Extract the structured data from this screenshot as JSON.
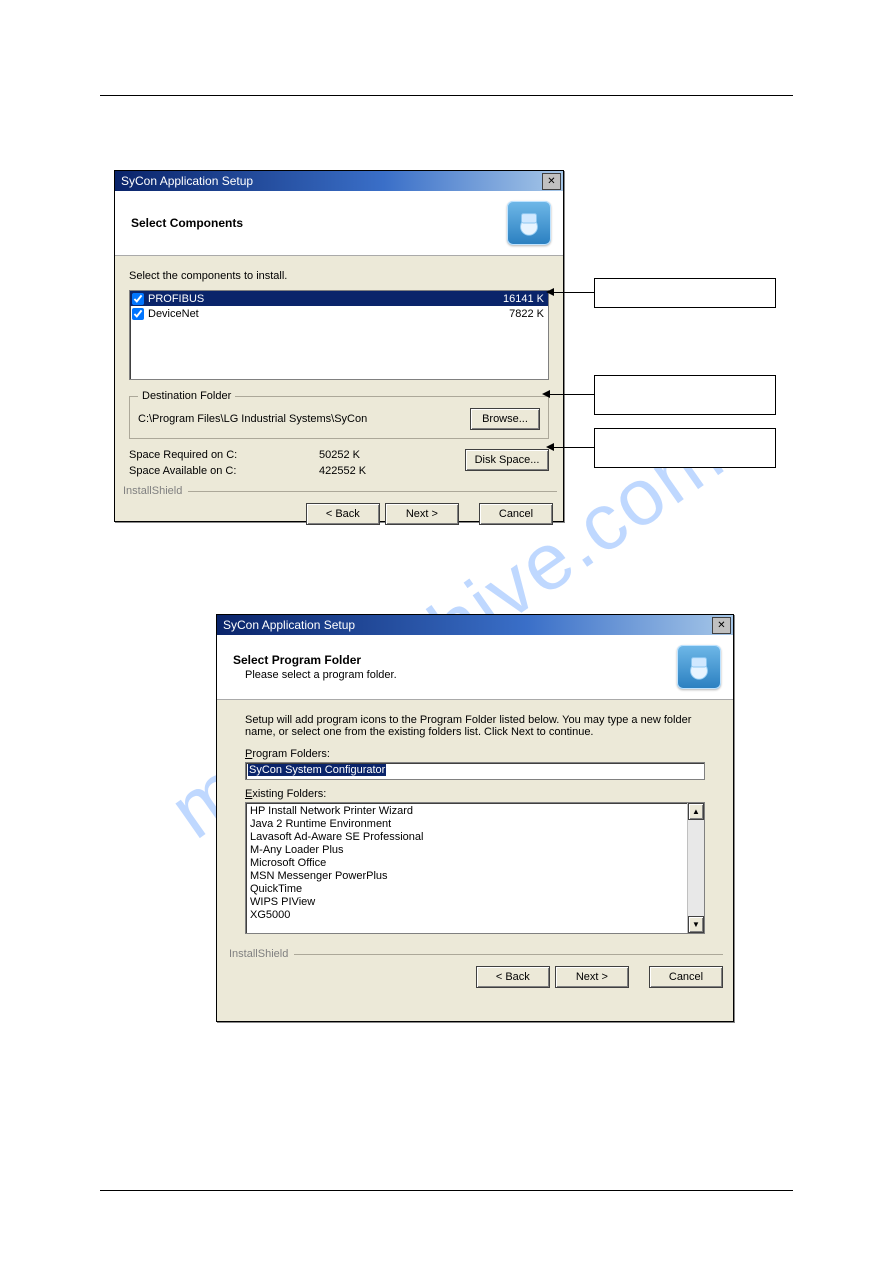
{
  "watermark": "manualshive.com",
  "dialog1": {
    "title": "SyCon Application Setup",
    "header": "Select Components",
    "instruction": "Select the components to install.",
    "components": [
      {
        "name": "PROFIBUS",
        "size": "16141 K",
        "selected": true,
        "checked": true
      },
      {
        "name": "DeviceNet",
        "size": "7822 K",
        "selected": false,
        "checked": true
      }
    ],
    "dest_label": "Destination Folder",
    "dest_path": "C:\\Program Files\\LG Industrial Systems\\SyCon",
    "browse": "Browse...",
    "space_required_label": "Space Required on C:",
    "space_required_value": "50252 K",
    "space_available_label": "Space Available on C:",
    "space_available_value": "422552 K",
    "disk_space": "Disk Space...",
    "installshield": "InstallShield",
    "back": "< Back",
    "next": "Next >",
    "cancel": "Cancel"
  },
  "dialog2": {
    "title": "SyCon Application Setup",
    "header": "Select Program Folder",
    "subheader": "Please select a program folder.",
    "body_text": "Setup will add program icons to the Program Folder listed below.  You may type a new folder name, or select one from the existing folders list.  Click Next to continue.",
    "program_folders_label": "Program Folders:",
    "program_folders_value": "SyCon System Configurator",
    "existing_label": "Existing Folders:",
    "existing": [
      "HP Install Network Printer Wizard",
      "Java 2 Runtime Environment",
      "Lavasoft Ad-Aware SE Professional",
      "M-Any Loader Plus",
      "Microsoft Office",
      "MSN Messenger PowerPlus",
      "QuickTime",
      "WIPS PIView",
      "XG5000"
    ],
    "installshield": "InstallShield",
    "back": "< Back",
    "next": "Next >",
    "cancel": "Cancel"
  }
}
